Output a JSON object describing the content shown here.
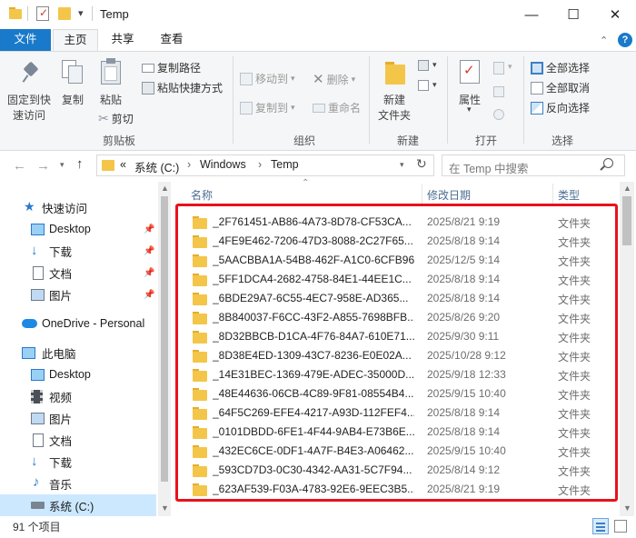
{
  "window": {
    "title": "Temp",
    "minimize": "—",
    "maximize": "☐",
    "close": "✕",
    "qa_dropdown": "▾"
  },
  "ribbon_tabs": [
    "文件",
    "主页",
    "共享",
    "查看"
  ],
  "ribbon": {
    "clipboard": {
      "pin_label_line1": "固定到快",
      "pin_label_line2": "速访问",
      "copy": "复制",
      "paste": "粘贴",
      "copy_path": "复制路径",
      "paste_shortcut": "粘贴快捷方式",
      "cut": "剪切",
      "group": "剪贴板"
    },
    "organize": {
      "move_to": "移动到",
      "copy_to": "复制到",
      "delete": "删除",
      "rename": "重命名",
      "group": "组织"
    },
    "new": {
      "new_folder_line1": "新建",
      "new_folder_line2": "文件夹",
      "group": "新建"
    },
    "open": {
      "properties": "属性",
      "group": "打开"
    },
    "select": {
      "select_all": "全部选择",
      "select_none": "全部取消",
      "invert": "反向选择",
      "group": "选择"
    }
  },
  "address": {
    "prefix": "«",
    "segments": [
      "系统 (C:)",
      "Windows",
      "Temp"
    ],
    "separator": "›",
    "search_placeholder": "在 Temp 中搜索"
  },
  "nav_pane": {
    "quick_access": "快速访问",
    "quick_items": [
      "Desktop",
      "下载",
      "文档",
      "图片"
    ],
    "onedrive": "OneDrive - Personal",
    "this_pc": "此电脑",
    "pc_items": [
      "Desktop",
      "视频",
      "图片",
      "文档",
      "下载",
      "音乐",
      "系统 (C:)"
    ]
  },
  "columns": {
    "name": "名称",
    "date": "修改日期",
    "type": "类型"
  },
  "files": [
    {
      "name": "_2F761451-AB86-4A73-8D78-CF53CA...",
      "date": "2025/8/21 9:19",
      "type": "文件夹"
    },
    {
      "name": "_4FE9E462-7206-47D3-8088-2C27F65...",
      "date": "2025/8/18 9:14",
      "type": "文件夹"
    },
    {
      "name": "_5AACBBA1A-54B8-462F-A1C0-6CFB96...",
      "date": "2025/12/5 9:14",
      "type": "文件夹"
    },
    {
      "name": "_5FF1DCA4-2682-4758-84E1-44EE1C...",
      "date": "2025/8/18 9:14",
      "type": "文件夹"
    },
    {
      "name": "_6BDE29A7-6C55-4EC7-958E-AD365...",
      "date": "2025/8/18 9:14",
      "type": "文件夹"
    },
    {
      "name": "_8B840037-F6CC-43F2-A855-7698BFB...",
      "date": "2025/8/26 9:20",
      "type": "文件夹"
    },
    {
      "name": "_8D32BBCB-D1CA-4F76-84A7-610E71...",
      "date": "2025/9/30 9:11",
      "type": "文件夹"
    },
    {
      "name": "_8D38E4ED-1309-43C7-8236-E0E02A...",
      "date": "2025/10/28 9:12",
      "type": "文件夹"
    },
    {
      "name": "_14E31BEC-1369-479E-ADEC-35000D...",
      "date": "2025/9/18 12:33",
      "type": "文件夹"
    },
    {
      "name": "_48E44636-06CB-4C89-9F81-08554B4...",
      "date": "2025/9/15 10:40",
      "type": "文件夹"
    },
    {
      "name": "_64F5C269-EFE4-4217-A93D-112FEF4...",
      "date": "2025/8/18 9:14",
      "type": "文件夹"
    },
    {
      "name": "_0101DBDD-6FE1-4F44-9AB4-E73B6E...",
      "date": "2025/8/18 9:14",
      "type": "文件夹"
    },
    {
      "name": "_432EC6CE-0DF1-4A7F-B4E3-A06462...",
      "date": "2025/9/15 10:40",
      "type": "文件夹"
    },
    {
      "name": "_593CD7D3-0C30-4342-AA31-5C7F94...",
      "date": "2025/8/14 9:12",
      "type": "文件夹"
    },
    {
      "name": "_623AF539-F03A-4783-92E6-9EEC3B5...",
      "date": "2025/8/21 9:19",
      "type": "文件夹"
    }
  ],
  "status": {
    "item_count": "91 个项目"
  },
  "colors": {
    "accent": "#1979ca",
    "highlight": "#e8121c",
    "folder": "#f3c64a",
    "nav_selected": "#cce8ff"
  }
}
